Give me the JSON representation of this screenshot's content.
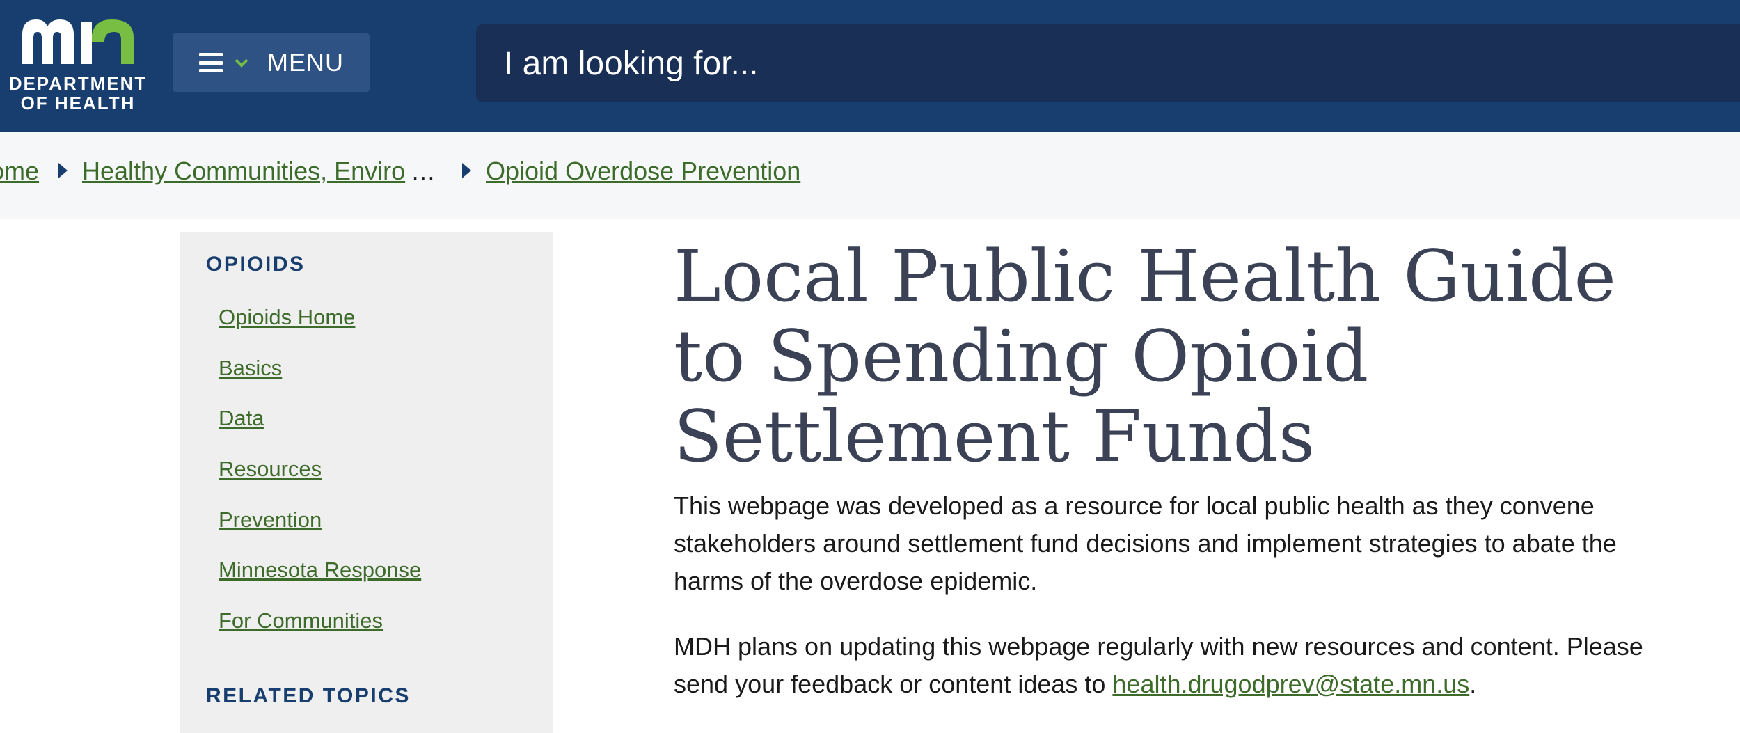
{
  "header": {
    "logo_text_line1": "DEPARTMENT",
    "logo_text_line2": "OF HEALTH",
    "menu_label": "MENU",
    "search_placeholder": "I am looking for...",
    "colors": {
      "background": "#173e6e",
      "search": "#1a2f55",
      "logo_green": "#78be43"
    }
  },
  "breadcrumb": {
    "items": [
      {
        "label": "Home"
      },
      {
        "label": "Healthy Communities, Enviro"
      },
      {
        "label": "Opioid Overdose Prevention"
      }
    ],
    "ellipsis": "…"
  },
  "sidebar": {
    "section_title": "OPIOIDS",
    "links": [
      {
        "label": "Opioids Home"
      },
      {
        "label": "Basics"
      },
      {
        "label": "Data"
      },
      {
        "label": "Resources"
      },
      {
        "label": "Prevention"
      },
      {
        "label": "Minnesota Response"
      },
      {
        "label": "For Communities"
      }
    ],
    "related_title": "RELATED TOPICS"
  },
  "main": {
    "title": "Local Public Health Guide to Spending Opioid Settlement Funds",
    "intro": "This webpage was developed as a resource for local public health as they convene stakeholders around settlement fund decisions and implement strategies to abate the harms of the overdose epidemic.",
    "update_text": "MDH plans on updating this webpage regularly with new resources and content. Please send your feedback or content ideas to ",
    "email": "health.drugodprev@state.mn.us",
    "update_end": "."
  }
}
